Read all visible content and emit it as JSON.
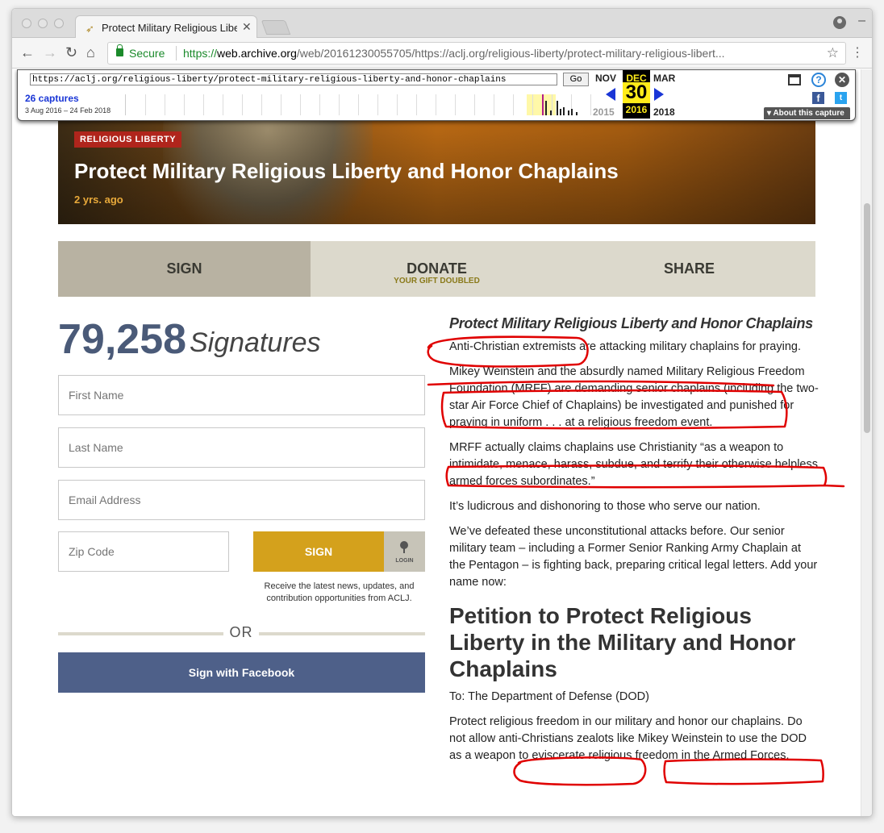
{
  "browser": {
    "tab_title": "Protect Military Religious Libe",
    "secure_label": "Secure",
    "url_scheme": "https://",
    "url_host": "web.archive.org",
    "url_path": "/web/20161230055705/https://aclj.org/religious-liberty/protect-military-religious-libert..."
  },
  "wayback": {
    "url": "https://aclj.org/religious-liberty/protect-military-religious-liberty-and-honor-chaplains",
    "go_label": "Go",
    "captures": "26 captures",
    "range": "3 Aug 2016 – 24 Feb 2018",
    "month_prev": "NOV",
    "month_cur": "DEC",
    "month_next": "MAR",
    "day": "30",
    "year_prev": "2015",
    "year_cur": "2016",
    "year_next": "2018",
    "about": "About this capture"
  },
  "hero": {
    "tag": "RELIGIOUS LIBERTY",
    "title": "Protect Military Religious Liberty and Honor Chaplains",
    "date": "2 yrs. ago"
  },
  "actions": {
    "sign": "SIGN",
    "donate": "DONATE",
    "donate_sub": "YOUR GIFT DOUBLED",
    "share": "SHARE"
  },
  "form": {
    "count": "79,258",
    "count_word": "Signatures",
    "first_name": "First Name",
    "last_name": "Last Name",
    "email": "Email Address",
    "zip": "Zip Code",
    "sign_button": "SIGN",
    "login": "LOGIN",
    "consent": "Receive the latest news, updates, and contribution opportunities from ACLJ.",
    "or": "OR",
    "facebook": "Sign with Facebook"
  },
  "article": {
    "heading": "Protect Military Religious Liberty and Honor Chaplains",
    "p1": "Anti-Christian extremists are attacking military chaplains for praying.",
    "p2": "Mikey Weinstein and the absurdly named Military Religious Freedom Foundation (MRFF) are demanding senior chaplains (including the two-star Air Force Chief of Chaplains) be investigated and punished for praying in uniform . . . at a religious freedom event.",
    "p3": "MRFF actually claims chaplains use Christianity “as a weapon to intimidate, menace, harass, subdue, and terrify their otherwise helpless armed forces subordinates.”",
    "p4": "It’s ludicrous and dishonoring to those who serve our nation.",
    "p5": "We’ve defeated these unconstitutional attacks before. Our senior military team – including a Former Senior Ranking Army Chaplain at the Pentagon – is fighting back, preparing critical legal letters. Add your name now:",
    "petition_title": "Petition to Protect Religious Liberty in the Military and Honor Chaplains",
    "to": "To: The Department of Defense (DOD)",
    "p6": "Protect religious freedom in our military and honor our chaplains. Do not allow anti-Christians zealots like Mikey Weinstein to use the DOD as a weapon to eviscerate religious freedom in the Armed Forces."
  },
  "colors": {
    "tag_red": "#b0251c",
    "sign_gold": "#d4a11c",
    "facebook_blue": "#4e6089",
    "count_blue": "#4a5a78",
    "annotation_red": "#e00000"
  }
}
